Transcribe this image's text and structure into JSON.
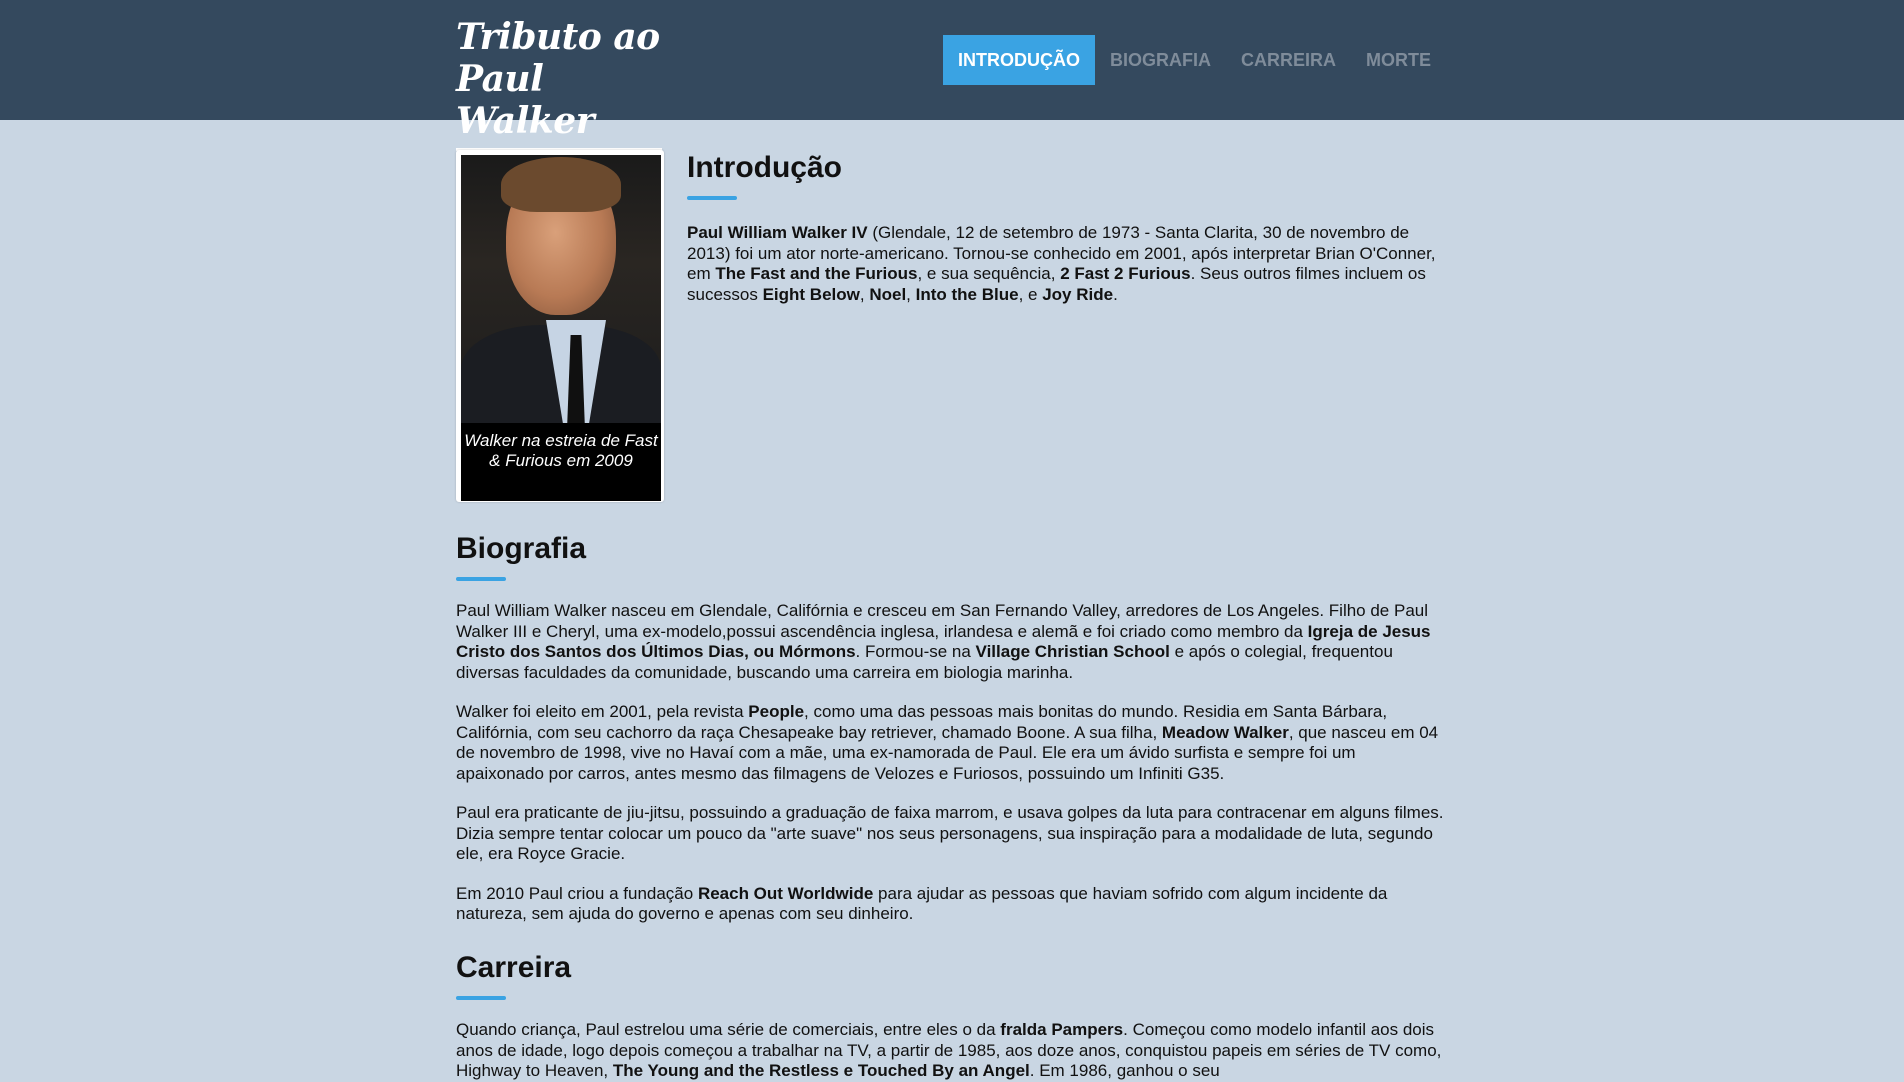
{
  "header": {
    "logo_line1": "Tributo ao",
    "logo_line2": "Paul Walker",
    "nav": [
      {
        "label": "INTRODUÇÃO",
        "active": true
      },
      {
        "label": "BIOGRAFIA",
        "active": false
      },
      {
        "label": "CARREIRA",
        "active": false
      },
      {
        "label": "MORTE",
        "active": false
      }
    ]
  },
  "figure": {
    "image_alt": "Paul Walker portrait",
    "caption": "Walker na estreia de Fast & Furious em 2009"
  },
  "intro": {
    "title": "Introdução",
    "parts": [
      {
        "b": "Paul William Walker IV"
      },
      {
        "t": " (Glendale, 12 de setembro de 1973 - Santa Clarita, 30 de novembro de 2013) foi um ator norte-americano. Tornou-se conhecido em 2001, após interpretar Brian O'Conner, em "
      },
      {
        "b": "The Fast and the Furious"
      },
      {
        "t": ", e sua sequência, "
      },
      {
        "b": "2 Fast 2 Furious"
      },
      {
        "t": ". Seus outros filmes incluem os sucessos "
      },
      {
        "b": "Eight Below"
      },
      {
        "t": ", "
      },
      {
        "b": "Noel"
      },
      {
        "t": ", "
      },
      {
        "b": "Into the Blue"
      },
      {
        "t": ", e "
      },
      {
        "b": "Joy Ride"
      },
      {
        "t": "."
      }
    ]
  },
  "biografia": {
    "title": "Biografia",
    "paragraphs": [
      [
        {
          "t": "Paul William Walker nasceu em Glendale, Califórnia e cresceu em San Fernando Valley, arredores de Los Angeles. Filho de Paul Walker III e Cheryl, uma ex-modelo,possui ascendência inglesa, irlandesa e alemã e foi criado como membro da "
        },
        {
          "b": "Igreja de Jesus Cristo dos Santos dos Últimos Dias, ou Mórmons"
        },
        {
          "t": ". Formou-se na "
        },
        {
          "b": "Village Christian School"
        },
        {
          "t": " e após o colegial, frequentou diversas faculdades da comunidade, buscando uma carreira em biologia marinha."
        }
      ],
      [
        {
          "t": "Walker foi eleito em 2001, pela revista "
        },
        {
          "b": "People"
        },
        {
          "t": ", como uma das pessoas mais bonitas do mundo. Residia em Santa Bárbara, Califórnia, com seu cachorro da raça Chesapeake bay retriever, chamado Boone. A sua filha, "
        },
        {
          "b": "Meadow Walker"
        },
        {
          "t": ", que nasceu em 04 de novembro de 1998, vive no Havaí com a mãe, uma ex-namorada de Paul. Ele era um ávido surfista e sempre foi um apaixonado por carros, antes mesmo das filmagens de Velozes e Furiosos, possuindo um Infiniti G35."
        }
      ],
      [
        {
          "t": "Paul era praticante de jiu-jitsu, possuindo a graduação de faixa marrom, e usava golpes da luta para contracenar em alguns filmes. Dizia sempre tentar colocar um pouco da \"arte suave\" nos seus personagens, sua inspiração para a modalidade de luta, segundo ele, era Royce Gracie."
        }
      ],
      [
        {
          "t": "Em 2010 Paul criou a fundação "
        },
        {
          "b": "Reach Out Worldwide"
        },
        {
          "t": " para ajudar as pessoas que haviam sofrido com algum incidente da natureza, sem ajuda do governo e apenas com seu dinheiro."
        }
      ]
    ]
  },
  "carreira": {
    "title": "Carreira",
    "paragraphs": [
      [
        {
          "t": "Quando criança, Paul estrelou uma série de comerciais, entre eles o da "
        },
        {
          "b": "fralda Pampers"
        },
        {
          "t": ". Começou como modelo infantil aos dois anos de idade, logo depois começou a trabalhar na TV, a partir de 1985, aos doze anos, conquistou papeis em séries de TV como, Highway to Heaven, "
        },
        {
          "b": "The Young and the Restless e Touched By an Angel"
        },
        {
          "t": ". Em 1986, ganhou o seu"
        }
      ]
    ]
  },
  "colors": {
    "header_bg": "#34495e",
    "page_bg": "#c9d6e3",
    "accent": "#3aa3e3",
    "nav_inactive": "#7f8c9a"
  }
}
